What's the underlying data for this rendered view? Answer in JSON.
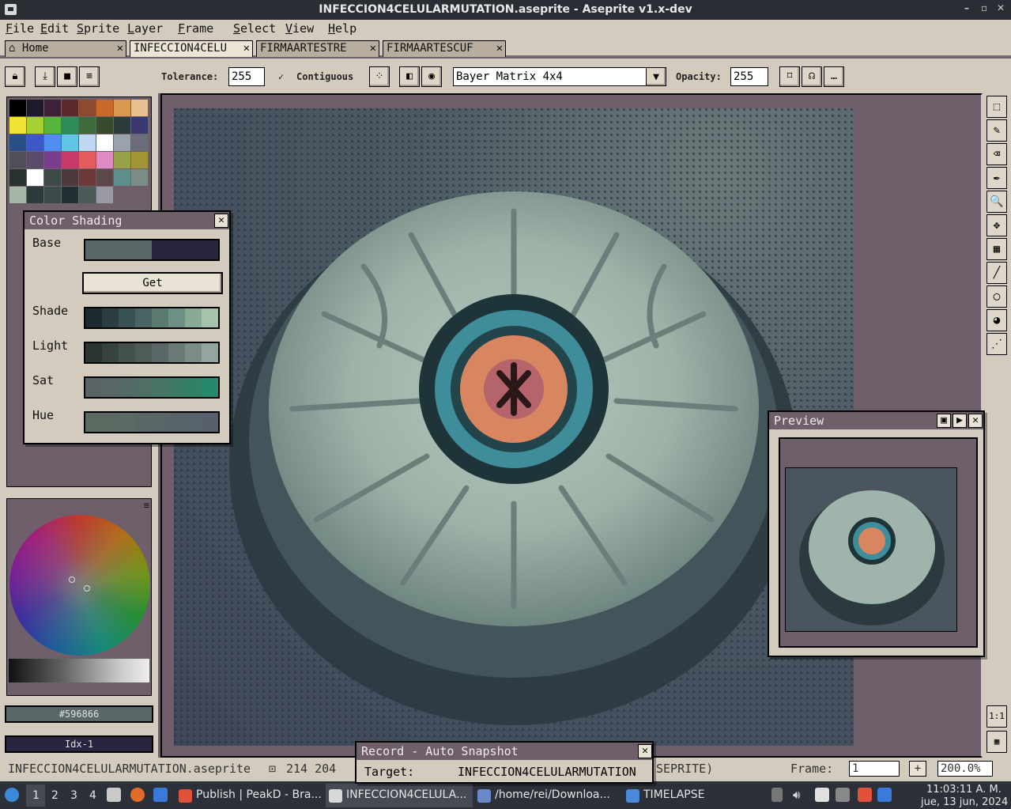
{
  "window": {
    "title": "INFECCION4CELULARMUTATION.aseprite - Aseprite v1.x-dev",
    "controls": [
      "–",
      "▫",
      "✕"
    ]
  },
  "menu": [
    {
      "first": "F",
      "rest": "ile"
    },
    {
      "first": "E",
      "rest": "dit"
    },
    {
      "first": "S",
      "rest": "prite"
    },
    {
      "first": "L",
      "rest": "ayer"
    },
    {
      "first": "F",
      "rest": "rame"
    },
    {
      "first": "S",
      "rest": "elect"
    },
    {
      "first": "V",
      "rest": "iew"
    },
    {
      "first": "H",
      "rest": "elp"
    }
  ],
  "tabs": [
    {
      "label": "Home",
      "close": "✕"
    },
    {
      "label": "INFECCION4CELU",
      "close": "✕"
    },
    {
      "label": "FIRMAARTESTRE",
      "close": "✕"
    },
    {
      "label": "FIRMAARTESCUF",
      "close": "✕"
    }
  ],
  "toolbar": {
    "tolerance_label": "Tolerance:",
    "tolerance_value": "255",
    "contiguous_label": "Contiguous",
    "dither_value": "Bayer Matrix 4x4",
    "opacity_label": "Opacity:",
    "opacity_value": "255",
    "more": "…"
  },
  "palette": [
    "#000000",
    "#1e1a2c",
    "#3c2138",
    "#5c2a2a",
    "#8d4a2e",
    "#c8692b",
    "#d99a4f",
    "#e8bf8e",
    "#f2e236",
    "#a6d132",
    "#59b43c",
    "#2f8b57",
    "#3d6b39",
    "#3a4a2c",
    "#2d3a3a",
    "#3a3870",
    "#2a4e86",
    "#3f58c8",
    "#4f8ef0",
    "#5ec7e6",
    "#bfd6f4",
    "#ffffff",
    "#9aa3ad",
    "#6b6e7a",
    "#4f4f57",
    "#5a4b6b",
    "#7a3d8e",
    "#c53a6a",
    "#e35b5b",
    "#e08ac4",
    "#99a04a",
    "#a39436",
    "#2a3230",
    "#ffffff",
    "#3c4a48",
    "#4d3a3a",
    "#6a3a3a",
    "#5c4a4a",
    "#5e8f8a",
    "#7a8c86",
    "#a5b8a8",
    "#2c3a3c",
    "#3a4a48",
    "#203032",
    "#4a5a58",
    "#9a9aa4"
  ],
  "color": {
    "hex": "#596866",
    "index": "Idx-1"
  },
  "color_shading": {
    "title": "Color Shading",
    "close": "✕",
    "base_label": "Base",
    "get_label": "Get",
    "shade_label": "Shade",
    "light_label": "Light",
    "sat_label": "Sat",
    "hue_label": "Hue",
    "base_colors": [
      "#596866",
      "#596866",
      "#596866",
      "#596866",
      "#2a2440",
      "#2a2440",
      "#2a2440",
      "#2a2440"
    ],
    "shade_colors": [
      "#1e2a30",
      "#2c3e42",
      "#3a5254",
      "#4a6664",
      "#5a7a72",
      "#6e9084",
      "#88aa96",
      "#a6c4ac"
    ],
    "light_colors": [
      "#2a3432",
      "#37433f",
      "#43504c",
      "#4e5c58",
      "#596866",
      "#6a7a76",
      "#7c8c88",
      "#94a4a0"
    ],
    "sat_colors": [
      "#5a6464",
      "#586666",
      "#546a66",
      "#4e6e66",
      "#467466",
      "#3c7a68",
      "#328068",
      "#26886c"
    ],
    "hue_colors": [
      "#5a6a5e",
      "#5a6a62",
      "#5a6a64",
      "#596866",
      "#586668",
      "#58646a",
      "#58626c",
      "#58606e"
    ]
  },
  "preview": {
    "title": "Preview",
    "close": "✕",
    "buttons": [
      "▣",
      "▶"
    ]
  },
  "record": {
    "title": "Record - Auto Snapshot",
    "close": "✕",
    "target_label": "Target:",
    "target_value": "INFECCION4CELULARMUTATION"
  },
  "status": {
    "filename": "INFECCION4CELULARMUTATION.aseprite",
    "size": "214 204",
    "suffix": "SEPRITE)",
    "frame_label": "Frame:",
    "frame_value": "1",
    "plus": "+",
    "zoom_value": "200.0%"
  },
  "tools": [
    "⬚",
    "✎",
    "⌫",
    "✒",
    "🔍",
    "✥",
    "▦",
    "╱",
    "◯",
    "◕",
    "⋰"
  ],
  "bottom_tools": [
    "1:1",
    "▦"
  ],
  "taskbar": {
    "workspaces": [
      "1",
      "2",
      "3",
      "4"
    ],
    "tasks": [
      {
        "label": "Publish | PeakD - Bra...",
        "color": "#e0513b"
      },
      {
        "label": "INFECCION4CELULA...",
        "color": "#d8d8d8"
      },
      {
        "label": "/home/rei/Downloa...",
        "color": "#6a89c8"
      },
      {
        "label": "TIMELAPSE",
        "color": "#4a8ad8"
      }
    ],
    "time": "11:03:11 A. M.",
    "date": "jue, 13 jun, 2024"
  }
}
